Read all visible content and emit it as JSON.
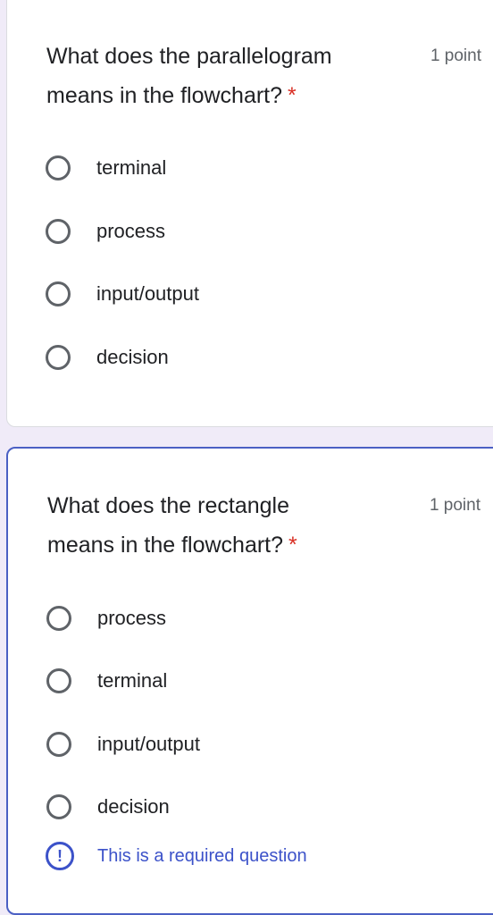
{
  "questions": [
    {
      "title_line1": "What does the parallelogram",
      "title_line2": "means in the flowchart?",
      "required_marker": "*",
      "points": "1 point",
      "options": [
        "terminal",
        "process",
        "input/output",
        "decision"
      ]
    },
    {
      "title_line1": "What does the rectangle",
      "title_line2": "means in the flowchart?",
      "required_marker": "*",
      "points": "1 point",
      "options": [
        "process",
        "terminal",
        "input/output",
        "decision"
      ],
      "error_icon": "!",
      "error_text": "This is a required question"
    }
  ],
  "colors": {
    "background": "#f0ebf8",
    "accent": "#3c52c9",
    "required": "#d93025"
  }
}
